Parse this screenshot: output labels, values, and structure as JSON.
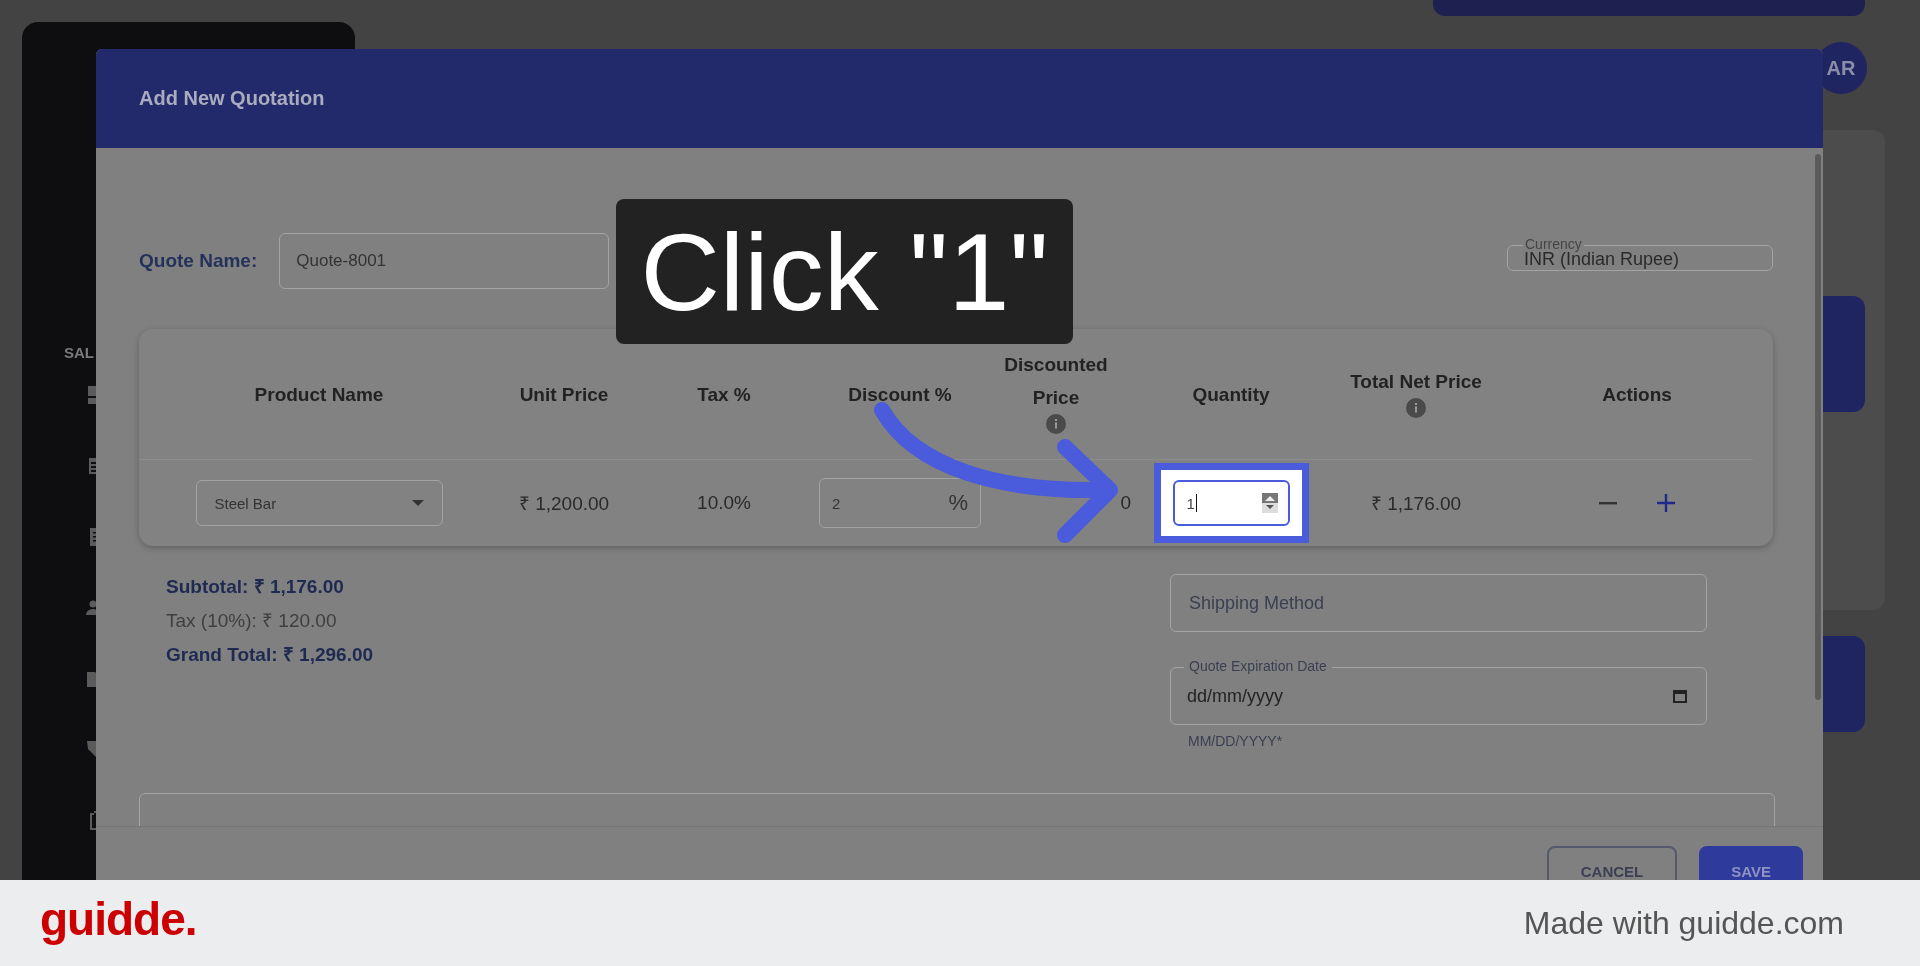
{
  "tutorial": {
    "caption": "Click \"1\""
  },
  "background": {
    "section_label": "SAL",
    "avatar": "AR"
  },
  "dialog": {
    "title": "Add New Quotation",
    "quote_name_label": "Quote Name:",
    "quote_name": "Quote-8001",
    "currency_label": "Currency",
    "currency": "INR (Indian Rupee)",
    "columns": [
      {
        "label": "Product Name",
        "info": false
      },
      {
        "label": "Unit Price",
        "info": false
      },
      {
        "label": "Tax %",
        "info": false
      },
      {
        "label": "Discount %",
        "info": false
      },
      {
        "label": "Discounted Price",
        "info": true
      },
      {
        "label": "Quantity",
        "info": false
      },
      {
        "label": "Total Net Price",
        "info": true
      },
      {
        "label": "Actions",
        "info": false
      }
    ],
    "rows": [
      {
        "product": "Steel Bar",
        "unit_price": "₹ 1,200.00",
        "tax": "10.0%",
        "discount": "2",
        "discount_unit": "%",
        "discounted_price": "0",
        "quantity": "1",
        "total": "₹ 1,176.00"
      }
    ],
    "subtotal": "Subtotal: ₹ 1,176.00",
    "tax": "Tax (10%): ₹ 120.00",
    "grand_total": "Grand Total: ₹ 1,296.00",
    "shipping_placeholder": "Shipping Method",
    "expiration_label": "Quote Expiration Date",
    "expiration_placeholder": "dd/mm/yyyy",
    "expiration_hint": "MM/DD/YYYY*",
    "buttons": [
      {
        "label": "CANCEL",
        "kind": "outlined"
      },
      {
        "label": "SAVE",
        "kind": "filled"
      }
    ]
  },
  "footer": {
    "logo": "guidde.",
    "credit": "Made with guidde.com"
  }
}
